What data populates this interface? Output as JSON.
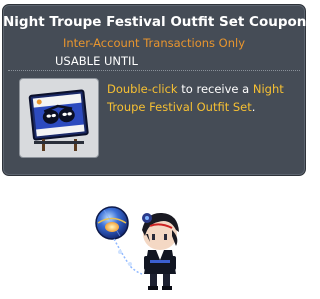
{
  "tooltip": {
    "title": "Night Troupe Festival Outfit Set Coupon",
    "trade_restriction": "Inter-Account Transactions Only",
    "usable_until": "USABLE UNTIL",
    "description": {
      "part1": "Double-click",
      "part2": " to receive a ",
      "part3": "Night",
      "part4": "Troupe Festival Outfit Set",
      "part5": "."
    },
    "item_icon": "outfit-coupon-icon"
  },
  "colors": {
    "tooltip_bg": "#454c56",
    "title": "#ffffff",
    "trade_restriction": "#e8952e",
    "highlight": "#f6c033",
    "body_text": "#ffffff"
  },
  "character": {
    "sprite": "character-with-balloon-sprite"
  }
}
